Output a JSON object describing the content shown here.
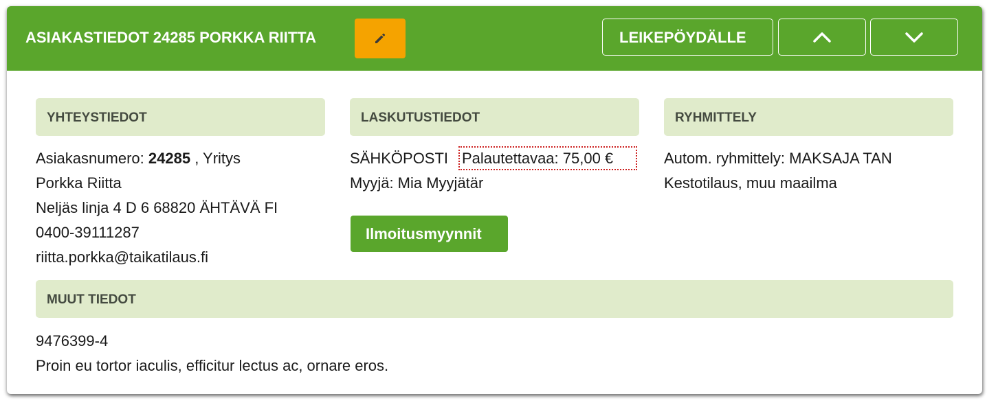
{
  "header": {
    "title": "ASIAKASTIEDOT 24285 PORKKA RIITTA",
    "edit_icon": "pencil-icon",
    "clipboard_label": "LEIKEPÖYDÄLLE",
    "up_icon": "chevron-up-icon",
    "down_icon": "chevron-down-icon",
    "bg_color": "#5aa62c",
    "edit_color": "#f5a300"
  },
  "contact": {
    "heading": "YHTEYSTIEDOT",
    "customer_number_label": "Asiakasnumero:",
    "customer_number": "24285",
    "customer_type": ", Yritys",
    "name": "Porkka Riitta",
    "address": "Neljäs linja 4 D 6 68820 ÄHTÄVÄ FI",
    "phone": "0400-39111287",
    "email": "riitta.porkka@taikatilaus.fi"
  },
  "billing": {
    "heading": "LASKUTUSTIEDOT",
    "method": "SÄHKÖPOSTI",
    "refund": "Palautettavaa: 75,00 €",
    "seller": "Myyjä: Mia Myyjätär",
    "ads_button": "Ilmoitusmyynnit"
  },
  "grouping": {
    "heading": "RYHMITTELY",
    "auto": "Autom. ryhmittely: MAKSAJA TAN",
    "subscription": "Kestotilaus, muu maailma"
  },
  "other": {
    "heading": "MUUT TIEDOT",
    "id": "9476399-4",
    "note": "Proin eu tortor iaculis, efficitur lectus ac, ornare eros."
  }
}
